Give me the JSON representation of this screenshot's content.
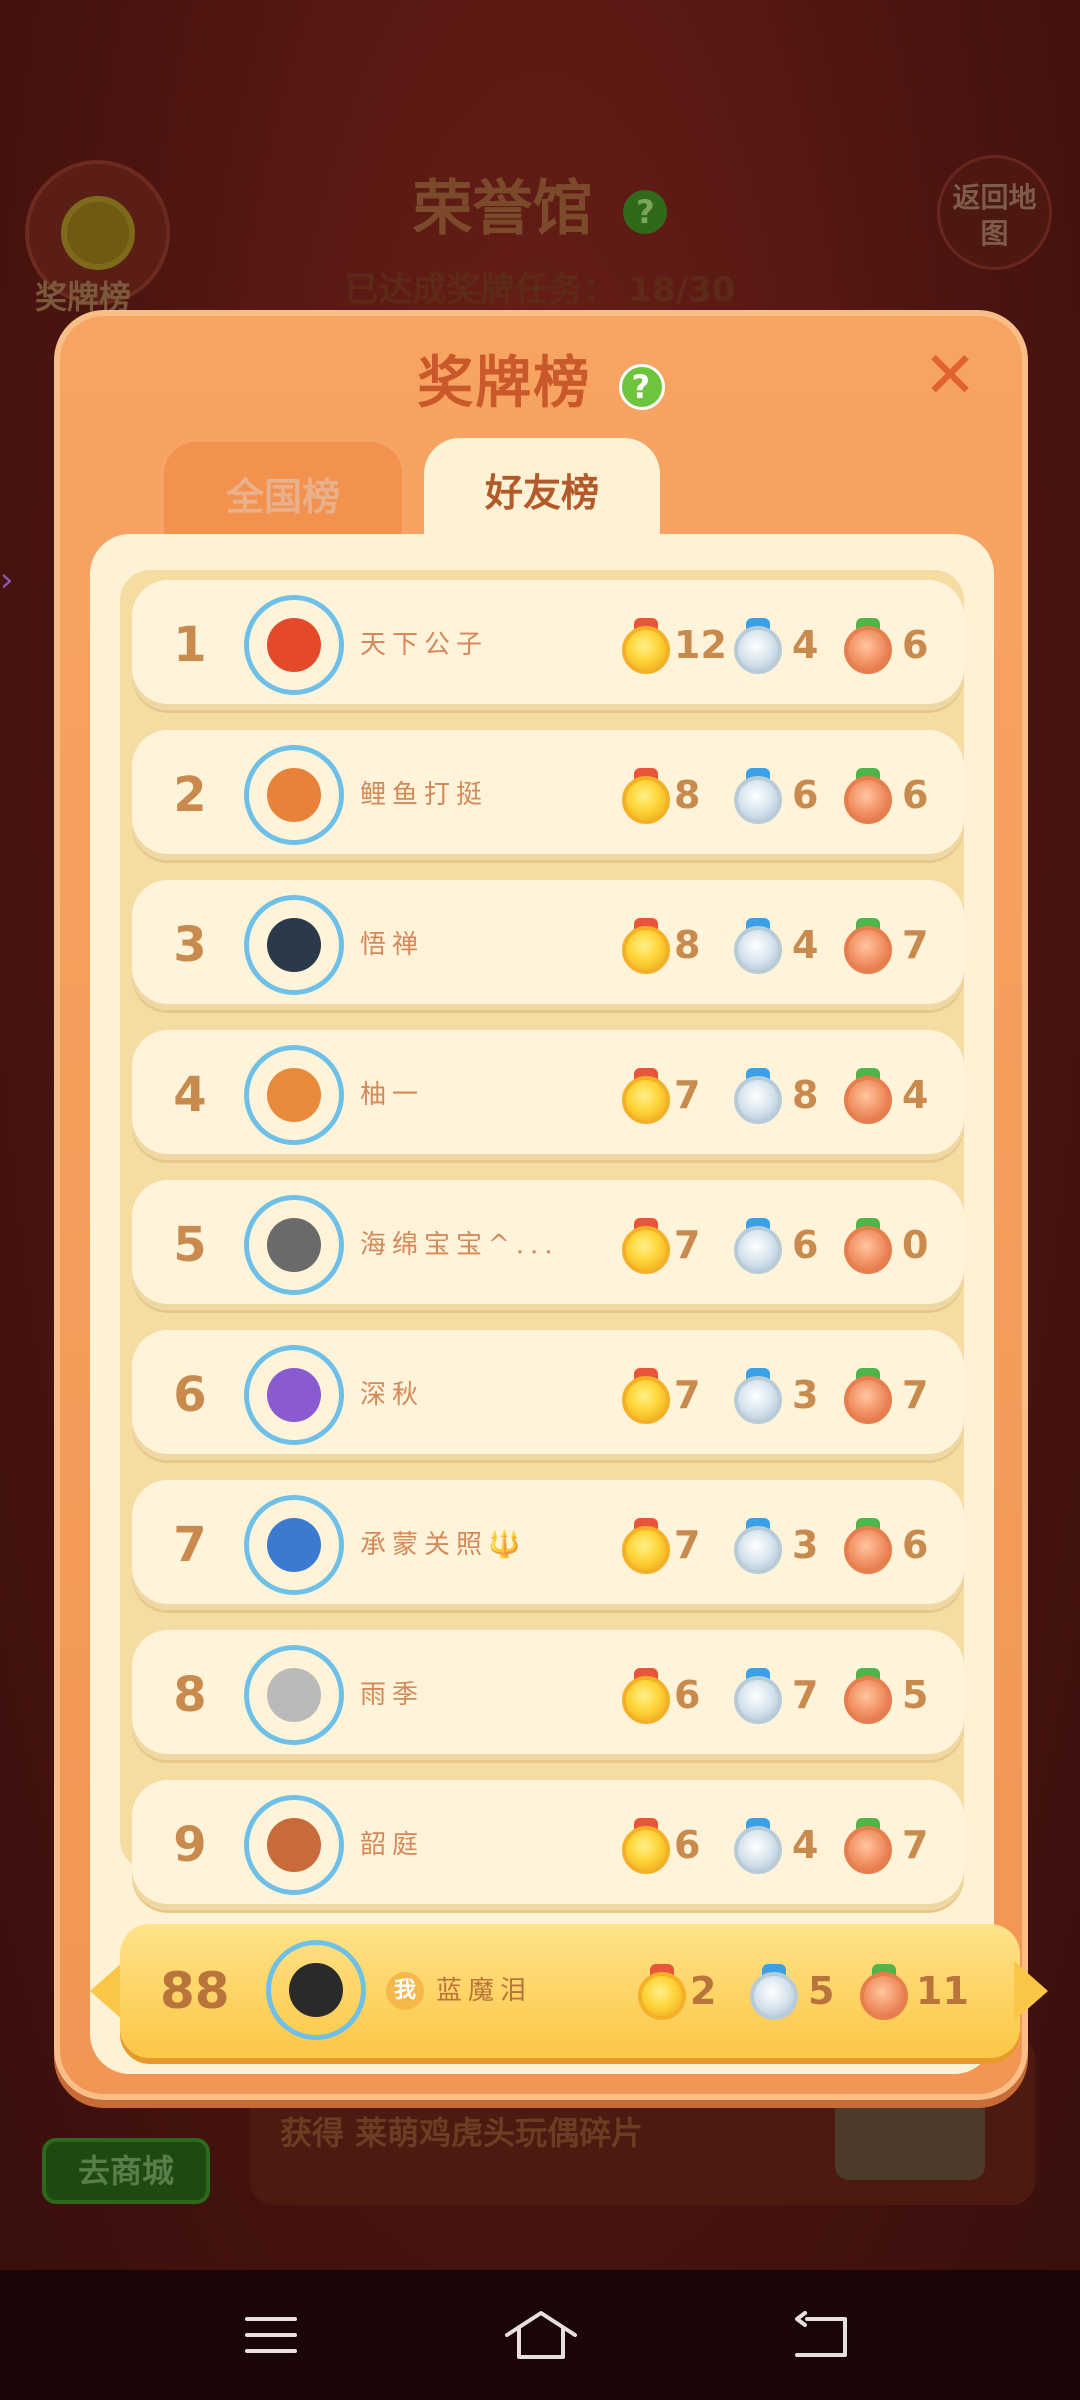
{
  "background": {
    "hall_title": "荣誉馆",
    "hall_help": "?",
    "progress_label": "已达成奖牌任务：",
    "progress_value": "18/30",
    "medal_button_label": "奖牌榜",
    "back_button_label": "返回地图",
    "reward_text": "获得 莱萌鸡虎头玩偶碎片",
    "shop_button_label": "去商城"
  },
  "modal": {
    "title": "奖牌榜",
    "help": "?",
    "close": "✕",
    "tabs": [
      {
        "label": "全国榜",
        "active": false
      },
      {
        "label": "好友榜",
        "active": true
      }
    ],
    "rankings": [
      {
        "rank": "1",
        "name": "天下公子",
        "gold": "12",
        "silver": "4",
        "bronze": "6",
        "avatar_color": "#e44a2a"
      },
      {
        "rank": "2",
        "name": "鲤鱼打挺",
        "gold": "8",
        "silver": "6",
        "bronze": "6",
        "avatar_color": "#e8823a"
      },
      {
        "rank": "3",
        "name": "悟禅",
        "gold": "8",
        "silver": "4",
        "bronze": "7",
        "avatar_color": "#2a3a4a"
      },
      {
        "rank": "4",
        "name": "柚一",
        "gold": "7",
        "silver": "8",
        "bronze": "4",
        "avatar_color": "#e88a3a"
      },
      {
        "rank": "5",
        "name": "海绵宝宝^...",
        "gold": "7",
        "silver": "6",
        "bronze": "0",
        "avatar_color": "#6a6a6a"
      },
      {
        "rank": "6",
        "name": "深秋",
        "gold": "7",
        "silver": "3",
        "bronze": "7",
        "avatar_color": "#8a5ad0"
      },
      {
        "rank": "7",
        "name": "承蒙关照🔱",
        "gold": "7",
        "silver": "3",
        "bronze": "6",
        "avatar_color": "#3a7ad0"
      },
      {
        "rank": "8",
        "name": "雨季",
        "gold": "6",
        "silver": "7",
        "bronze": "5",
        "avatar_color": "#bababa"
      },
      {
        "rank": "9",
        "name": "韶庭",
        "gold": "6",
        "silver": "4",
        "bronze": "7",
        "avatar_color": "#c86a3a"
      }
    ],
    "me": {
      "rank": "88",
      "badge": "我",
      "name": "蓝魔泪",
      "gold": "2",
      "silver": "5",
      "bronze": "11",
      "avatar_color": "#2a2a2a"
    }
  },
  "system_nav": {
    "icons": [
      "menu-icon",
      "home-icon",
      "back-icon"
    ]
  }
}
